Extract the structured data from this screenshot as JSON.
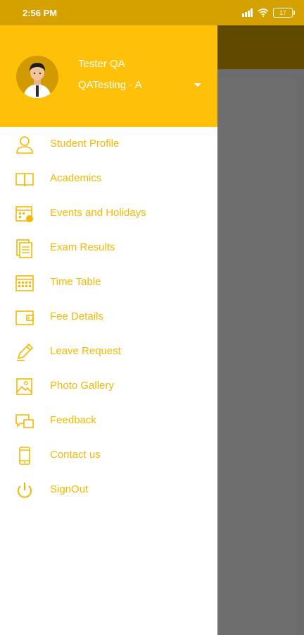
{
  "status_bar": {
    "time": "2:56 PM",
    "battery": "17"
  },
  "drawer": {
    "user_name": "Tester QA",
    "user_class": "QATesting - A",
    "menu": [
      {
        "label": "Student Profile",
        "icon": "person-icon"
      },
      {
        "label": "Academics",
        "icon": "book-icon"
      },
      {
        "label": "Events and Holidays",
        "icon": "calendar-icon"
      },
      {
        "label": "Exam Results",
        "icon": "results-icon"
      },
      {
        "label": "Time Table",
        "icon": "timetable-icon"
      },
      {
        "label": "Fee Details",
        "icon": "wallet-icon"
      },
      {
        "label": "Leave Request",
        "icon": "pencil-icon"
      },
      {
        "label": "Photo Gallery",
        "icon": "photo-icon"
      },
      {
        "label": "Feedback",
        "icon": "feedback-icon"
      },
      {
        "label": "Contact us",
        "icon": "phone-icon"
      },
      {
        "label": "SignOut",
        "icon": "power-icon"
      }
    ]
  },
  "colors": {
    "accent": "#ffc107",
    "status_bar": "#d4a100",
    "menu_text": "#f5b800"
  }
}
